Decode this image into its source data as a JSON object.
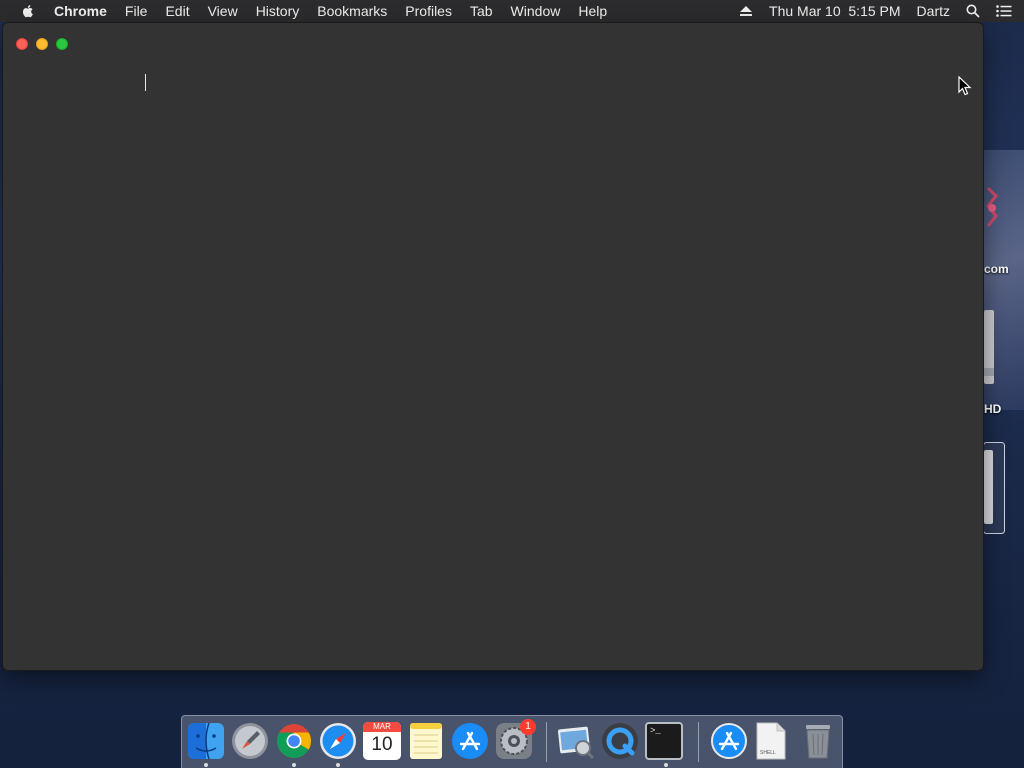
{
  "menubar": {
    "apple_icon": "apple-icon",
    "app_name": "Chrome",
    "items": [
      "File",
      "Edit",
      "View",
      "History",
      "Bookmarks",
      "Profiles",
      "Tab",
      "Window",
      "Help"
    ],
    "status": {
      "eject_icon": "eject-icon",
      "datetime": "Thu Mar 10  5:15 PM",
      "user": "Dartz",
      "search_icon": "spotlight-search-icon",
      "notification_icon": "notification-center-icon"
    }
  },
  "window": {
    "app": "Chrome",
    "controls": [
      "close",
      "minimize",
      "zoom"
    ],
    "content": ""
  },
  "desktop": {
    "labels": [
      "com",
      "HD"
    ]
  },
  "dock": {
    "items": [
      {
        "name": "Finder",
        "icon": "finder-icon",
        "running": true
      },
      {
        "name": "Launchpad",
        "icon": "launchpad-icon",
        "running": false
      },
      {
        "name": "Google Chrome",
        "icon": "chrome-icon",
        "running": true
      },
      {
        "name": "Safari",
        "icon": "safari-icon",
        "running": true
      },
      {
        "name": "Calendar",
        "icon": "calendar-icon",
        "running": false,
        "month": "MAR",
        "day": "10"
      },
      {
        "name": "Notes",
        "icon": "notes-icon",
        "running": false
      },
      {
        "name": "App Store",
        "icon": "app-store-icon",
        "running": false
      },
      {
        "name": "System Preferences",
        "icon": "system-preferences-icon",
        "running": false,
        "badge": "1"
      },
      {
        "name": "Preview",
        "icon": "preview-icon",
        "running": false
      },
      {
        "name": "QuickTime Player",
        "icon": "quicktime-icon",
        "running": false
      },
      {
        "name": "Terminal",
        "icon": "terminal-icon",
        "running": true
      },
      {
        "name": "Downloads",
        "icon": "app-store-download-icon",
        "running": false
      },
      {
        "name": "Shell document",
        "icon": "shell-document-icon",
        "running": false,
        "label": "SHELL"
      },
      {
        "name": "Trash",
        "icon": "trash-icon",
        "running": false
      }
    ]
  }
}
